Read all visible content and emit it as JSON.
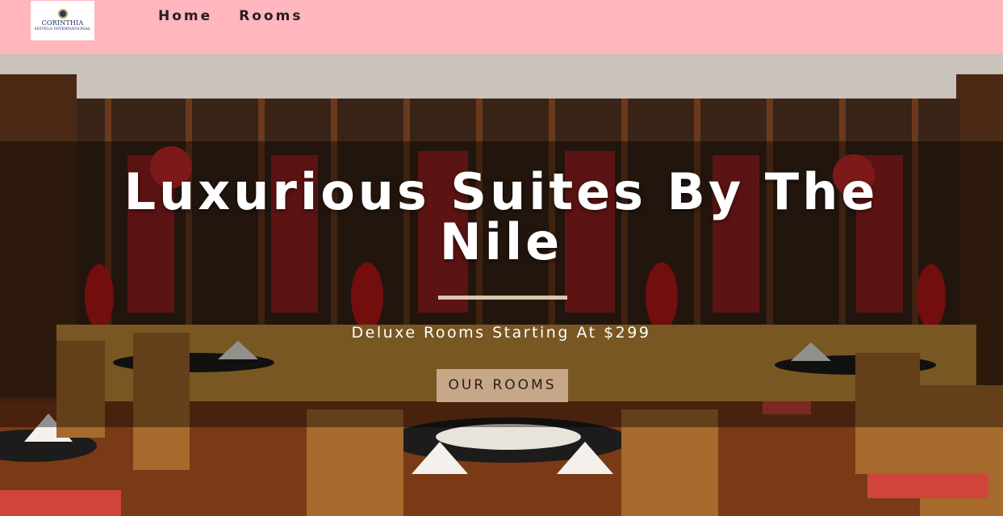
{
  "header": {
    "logo": {
      "name": "CORINTHIA",
      "subtitle": "HOTELS INTERNATIONAL"
    },
    "nav": [
      {
        "label": "Home"
      },
      {
        "label": "Rooms"
      }
    ],
    "background_color": "#ffb6bd"
  },
  "hero": {
    "title": "Luxurious Suites By The Nile",
    "subtitle": "Deluxe Rooms Starting At $299",
    "button_label": "OUR ROOMS",
    "button_color": "#c6a787",
    "image": "restaurant-interior-photo"
  }
}
